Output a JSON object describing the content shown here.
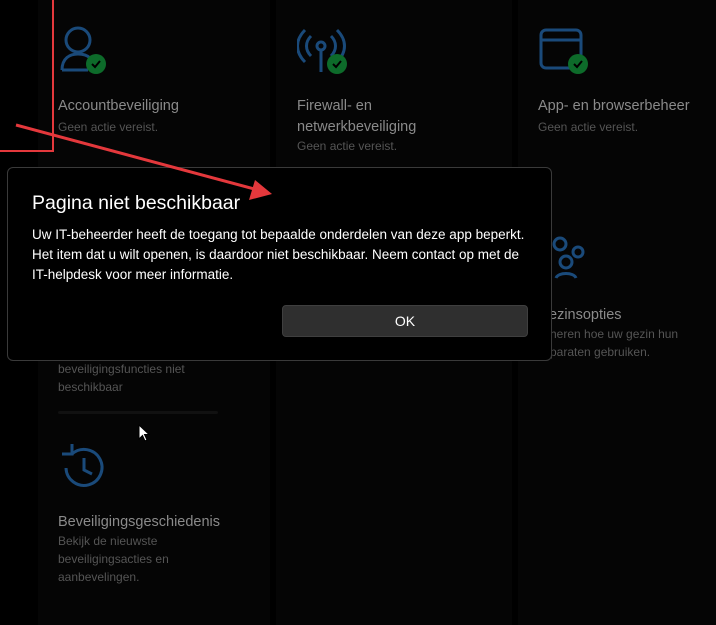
{
  "tiles": {
    "account": {
      "title": "Accountbeveiliging",
      "desc": "Geen actie vereist."
    },
    "firewall": {
      "title_line1": "Firewall- en",
      "title_line2": "netwerkbeveiliging",
      "desc": "Geen actie vereist."
    },
    "app_browser": {
      "title": "App- en browserbeheer",
      "desc": "Geen actie vereist."
    },
    "family": {
      "title": "Gezinsopties",
      "title_visible": "ezinsopties",
      "desc_line1": "heren hoe uw gezin hun",
      "desc_line2": "paraten gebruiken."
    },
    "device_security": {
      "desc_line1": "beveiligingsfuncties niet",
      "desc_line2": "beschikbaar"
    },
    "history": {
      "title": "Beveiligingsgeschiedenis",
      "desc_line1": "Bekijk de nieuwste",
      "desc_line2": "beveiligingsacties en",
      "desc_line3": "aanbevelingen."
    }
  },
  "dialog": {
    "title": "Pagina niet beschikbaar",
    "body": "Uw IT-beheerder heeft de toegang tot bepaalde onderdelen van deze app beperkt. Het item dat u wilt openen, is daardoor niet beschikbaar. Neem contact op met de IT-helpdesk voor meer informatie.",
    "ok_label": "OK"
  },
  "colors": {
    "icon_blue": "#1a4a7a",
    "status_green": "#0d6b2a",
    "annotation_red": "#e4383c"
  },
  "icons": {
    "account": "person-icon",
    "firewall": "antenna-icon",
    "app_browser": "browser-window-icon",
    "family": "family-icon",
    "history": "history-clock-icon",
    "status": "checkmark-icon"
  }
}
